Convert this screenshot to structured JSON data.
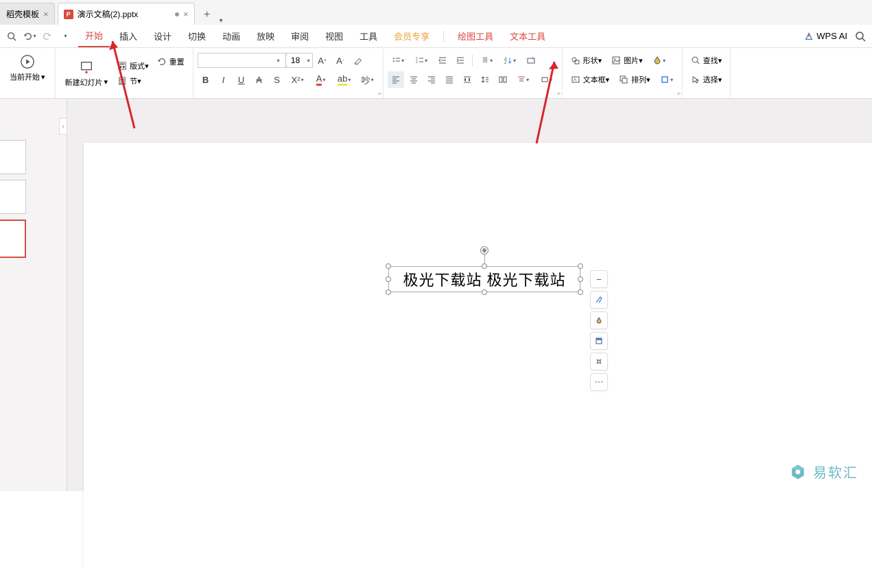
{
  "tabs": {
    "items": [
      {
        "title": "稻壳模板",
        "icon_letter": "",
        "has_close": true,
        "has_dot": false
      },
      {
        "title": "演示文稿(2).pptx",
        "icon_letter": "P",
        "has_close": true,
        "has_dot": true
      }
    ]
  },
  "menu": {
    "tabs": [
      "开始",
      "插入",
      "设计",
      "切换",
      "动画",
      "放映",
      "审阅",
      "视图",
      "工具",
      "会员专享"
    ],
    "special_tabs": [
      "绘图工具",
      "文本工具"
    ],
    "active_index": 0,
    "wps_ai": "WPS AI"
  },
  "ribbon": {
    "start_btn": "当前开始",
    "new_slide": "新建幻灯片",
    "layout": "版式",
    "section": "节",
    "reset": "重置",
    "font_name": "",
    "font_size": "18",
    "shape": "形状",
    "picture": "图片",
    "textbox": "文本框",
    "arrange": "排列",
    "find": "查找",
    "select": "选择"
  },
  "canvas": {
    "textbox_content": "极光下载站 极光下载站"
  },
  "watermark": "易软汇",
  "icons": {
    "search": "search-icon",
    "undo": "undo-icon",
    "redo": "redo-icon"
  }
}
